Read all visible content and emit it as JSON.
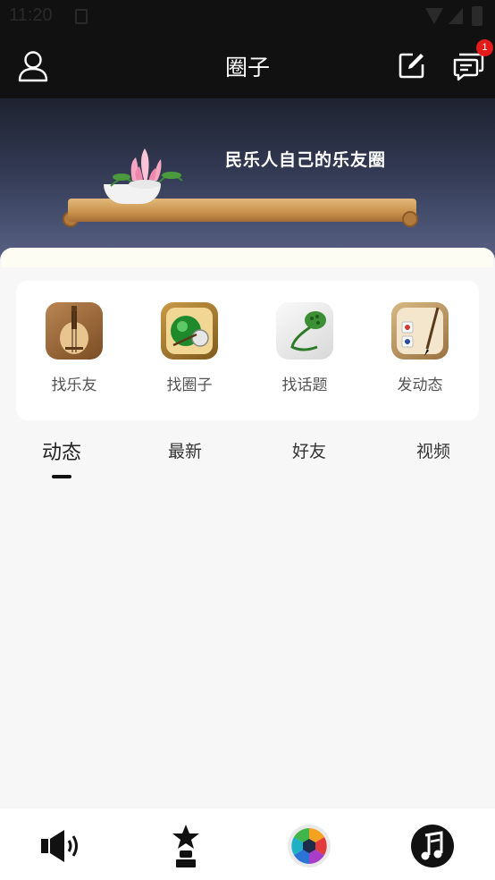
{
  "status_bar": {
    "time": "11:20"
  },
  "header": {
    "title": "圈子",
    "message_badge": "1",
    "icons": [
      "user-icon",
      "edit-icon",
      "message-icon"
    ]
  },
  "banner": {
    "slogan": "民乐人自己的乐友圈"
  },
  "quick_actions": [
    {
      "label": "找乐友",
      "icon": "pipa-icon"
    },
    {
      "label": "找圈子",
      "icon": "gong-icon"
    },
    {
      "label": "找话题",
      "icon": "lotus-pod-icon"
    },
    {
      "label": "发动态",
      "icon": "brush-icon"
    }
  ],
  "tabs": [
    {
      "label": "动态",
      "active": true
    },
    {
      "label": "最新",
      "active": false
    },
    {
      "label": "好友",
      "active": false
    },
    {
      "label": "视频",
      "active": false
    }
  ],
  "bottom_nav": [
    {
      "icon": "speaker-icon"
    },
    {
      "icon": "star-trophy-icon"
    },
    {
      "icon": "color-wheel-icon"
    },
    {
      "icon": "music-note-icon",
      "active": true
    }
  ],
  "colors": {
    "header_bg": "#111111",
    "badge": "#e41b1b",
    "page_bg": "#f7f7f7"
  }
}
